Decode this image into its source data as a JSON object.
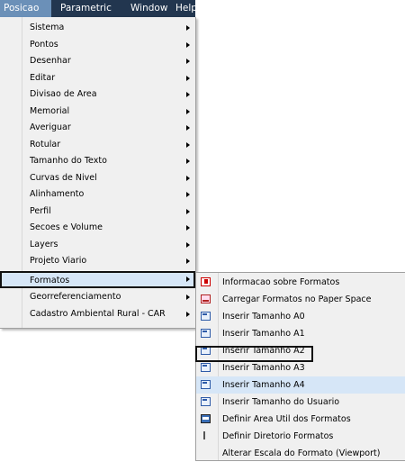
{
  "menubar": {
    "items": [
      "Posicao",
      "Parametric",
      "Window",
      "Help"
    ]
  },
  "main_menu": {
    "items": [
      "Sistema",
      "Pontos",
      "Desenhar",
      "Editar",
      "Divisao de Area",
      "Memorial",
      "Averiguar",
      "Rotular",
      "Tamanho do Texto",
      "Curvas de Nivel",
      "Alinhamento",
      "Perfil",
      "Secoes e Volume",
      "Layers",
      "Projeto Viario",
      "Formatos",
      "Georreferenciamento",
      "Cadastro Ambiental Rural - CAR"
    ],
    "highlighted": "Formatos"
  },
  "submenu": {
    "items": [
      {
        "label": "Informacao sobre Formatos",
        "icon": "help-icon"
      },
      {
        "label": "Carregar Formatos no Paper Space",
        "icon": "load-format-icon"
      },
      {
        "label": "Inserir Tamanho A0",
        "icon": "a0-icon"
      },
      {
        "label": "Inserir Tamanho A1",
        "icon": "a1-icon"
      },
      {
        "label": "Inserir Tamanho A2",
        "icon": "a2-icon"
      },
      {
        "label": "Inserir Tamanho A3",
        "icon": "a3-icon"
      },
      {
        "label": "Inserir Tamanho A4",
        "icon": "a4-icon"
      },
      {
        "label": "Inserir Tamanho do Usuario",
        "icon": "user-size-icon"
      },
      {
        "label": "Definir Area Util dos Formatos",
        "icon": "area-icon"
      },
      {
        "label": "Definir Diretorio Formatos",
        "icon": "directory-icon"
      },
      {
        "label": "Alterar Escala do Formato (Viewport)",
        "icon": ""
      }
    ],
    "highlighted": "Inserir Tamanho A4"
  },
  "colors": {
    "menubar_bg": "#22364f",
    "menubar_active": "#6b90b8",
    "menu_bg": "#f0f0f0",
    "highlight_bg": "#d6e6f7"
  }
}
